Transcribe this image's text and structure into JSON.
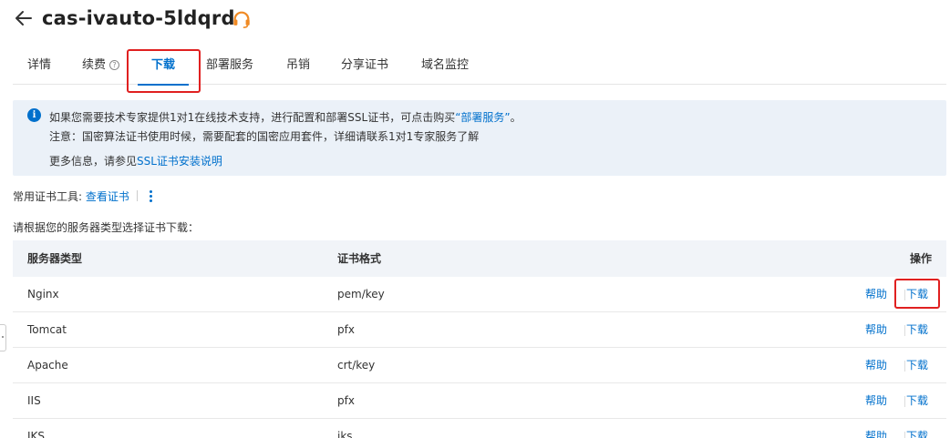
{
  "header": {
    "title": "cas-ivauto-5ldqrd",
    "back_icon": "arrow-left-icon",
    "support_icon": "headset-icon"
  },
  "tabs": [
    {
      "label": "详情"
    },
    {
      "label": "续费"
    },
    {
      "label": "下载",
      "active": true
    },
    {
      "label": "部署服务"
    },
    {
      "label": "吊销"
    },
    {
      "label": "分享证书"
    },
    {
      "label": "域名监控"
    }
  ],
  "info": {
    "line1_prefix": "如果您需要技术专家提供1对1在线技术支持，进行配置和部署SSL证书，可点击购买",
    "line1_link": "“部署服务”",
    "line1_suffix": "。",
    "line2": "注意：国密算法证书使用时候，需要配套的国密应用套件，详细请联系1对1专家服务了解",
    "line3_prefix": "更多信息，请参见",
    "line3_link": "SSL证书安装说明"
  },
  "tools": {
    "label": "常用证书工具:",
    "link": "查看证书"
  },
  "select_hint": "请根据您的服务器类型选择证书下载：",
  "table": {
    "headers": {
      "server_type": "服务器类型",
      "format": "证书格式",
      "action": "操作"
    },
    "help_label": "帮助",
    "download_label": "下载",
    "rows": [
      {
        "server": "Nginx",
        "format": "pem/key"
      },
      {
        "server": "Tomcat",
        "format": "pfx"
      },
      {
        "server": "Apache",
        "format": "crt/key"
      },
      {
        "server": "IIS",
        "format": "pfx"
      },
      {
        "server": "JKS",
        "format": "jks"
      }
    ]
  },
  "colors": {
    "accent": "#0070cc",
    "highlight": "#e02020",
    "info_bg": "#ebf1f8",
    "support_icon": "#f08a24"
  }
}
